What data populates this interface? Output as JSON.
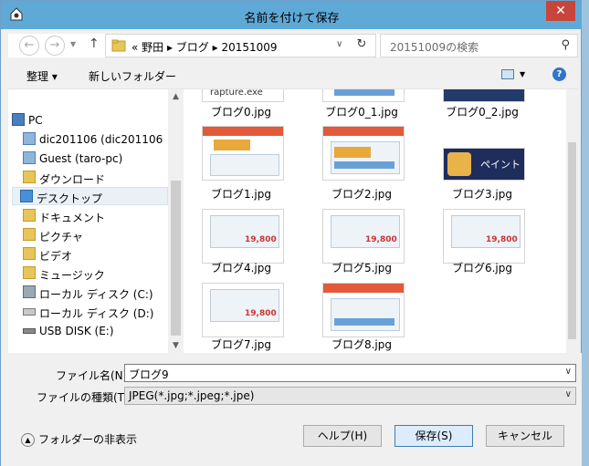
{
  "window": {
    "title": "名前を付けて保存",
    "close_label": "✕"
  },
  "nav": {
    "back_icon": "back-arrow-icon",
    "forward_icon": "forward-arrow-icon",
    "recent_icon": "chevron-down-icon",
    "up_icon": "up-arrow-icon"
  },
  "address": {
    "crumbs": "«  野田  ▸  ブログ  ▸  20151009",
    "refresh_icon": "refresh-icon"
  },
  "search": {
    "placeholder": "20151009の検索"
  },
  "toolbar": {
    "organize_label": "整理 ▾",
    "new_folder_label": "新しいフォルダー"
  },
  "tree": {
    "items": [
      {
        "label": "PC",
        "icon": "pc-icon"
      },
      {
        "label": "dic201106 (dic201106",
        "icon": "network-user-icon"
      },
      {
        "label": "Guest (taro-pc)",
        "icon": "network-user-icon"
      },
      {
        "label": "ダウンロード",
        "icon": "downloads-folder-icon"
      },
      {
        "label": "デスクトップ",
        "icon": "desktop-folder-icon",
        "selected": true
      },
      {
        "label": "ドキュメント",
        "icon": "documents-folder-icon"
      },
      {
        "label": "ピクチャ",
        "icon": "pictures-folder-icon"
      },
      {
        "label": "ビデオ",
        "icon": "videos-folder-icon"
      },
      {
        "label": "ミュージック",
        "icon": "music-folder-icon"
      },
      {
        "label": "ローカル ディスク (C:)",
        "icon": "local-disk-icon"
      },
      {
        "label": "ローカル ディスク (D:)",
        "icon": "disk-drive-icon"
      },
      {
        "label": "USB DISK (E:)",
        "icon": "usb-drive-icon"
      }
    ]
  },
  "files": {
    "items": [
      {
        "name": "ブログ0.jpg",
        "thumb_text": "rapture.exe"
      },
      {
        "name": "ブログ0_1.jpg"
      },
      {
        "name": "ブログ0_2.jpg"
      },
      {
        "name": "ブログ1.jpg"
      },
      {
        "name": "ブログ2.jpg"
      },
      {
        "name": "ブログ3.jpg",
        "thumb_text": "ペイント"
      },
      {
        "name": "ブログ4.jpg",
        "thumb_text": "19,800"
      },
      {
        "name": "ブログ5.jpg",
        "thumb_text": "19,800"
      },
      {
        "name": "ブログ6.jpg",
        "thumb_text": "19,800"
      },
      {
        "name": "ブログ7.jpg",
        "thumb_text": "19,800"
      },
      {
        "name": "ブログ8.jpg"
      }
    ]
  },
  "form": {
    "filename_label": "ファイル名(N):",
    "filename_value": "ブログ9",
    "filetype_label": "ファイルの種類(T):",
    "filetype_value": "JPEG(*.jpg;*.jpeg;*.jpe)"
  },
  "footer": {
    "hide_folders_label": "フォルダーの非表示",
    "help_button": "ヘルプ(H)",
    "save_button": "保存(S)",
    "cancel_button": "キャンセル"
  },
  "colors": {
    "titlebar": "#5fa9d6",
    "close": "#c7463c",
    "accent": "#2f75c9"
  }
}
